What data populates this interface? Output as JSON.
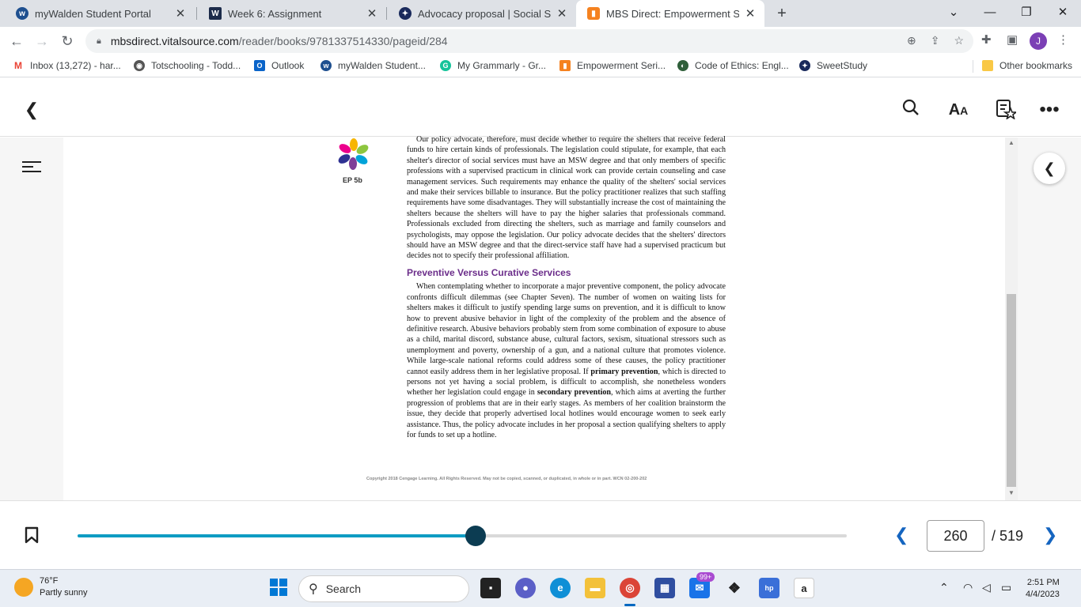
{
  "browser": {
    "tabs": [
      {
        "title": "myWalden Student Portal",
        "icon": "walden-icon",
        "color": "#1e4f8f"
      },
      {
        "title": "Week 6: Assignment",
        "icon": "walden-w-icon",
        "color": "#1c2b4a"
      },
      {
        "title": "Advocacy proposal | Social Scienc",
        "icon": "sweetstudy-icon",
        "color": "#1a2a5c"
      },
      {
        "title": "MBS Direct: Empowerment Series",
        "icon": "mbs-icon",
        "color": "#f58220"
      }
    ],
    "new_tab": "+",
    "url_host": "mbsdirect.vitalsource.com",
    "url_path": "/reader/books/9781337514330/pageid/284",
    "profile_initial": "J",
    "bookmarks": [
      {
        "label": "Inbox (13,272) - har...",
        "icon": "gmail-icon",
        "color": "#ea4335"
      },
      {
        "label": "Totschooling - Todd...",
        "icon": "totschooling-icon",
        "color": "#555555"
      },
      {
        "label": "Outlook",
        "icon": "outlook-icon",
        "color": "#0a64c9"
      },
      {
        "label": "myWalden Student...",
        "icon": "walden-icon",
        "color": "#1e4f8f"
      },
      {
        "label": "My Grammarly - Gr...",
        "icon": "grammarly-icon",
        "color": "#15c39a"
      },
      {
        "label": "Empowerment Seri...",
        "icon": "mbs-icon",
        "color": "#f58220"
      },
      {
        "label": "Code of Ethics: Engl...",
        "icon": "nasw-icon",
        "color": "#2f5f3a"
      },
      {
        "label": "SweetStudy",
        "icon": "sweetstudy-icon",
        "color": "#1a2a5c"
      }
    ],
    "other_bookmarks": "Other bookmarks"
  },
  "book": {
    "ep_label": "EP 5b",
    "para1": "Our policy advocate, therefore, must decide whether to require the shelters that receive federal funds to hire certain kinds of professionals. The legislation could stipulate, for example, that each shelter's director of social services must have an MSW degree and that only members of specific professions with a supervised practicum in clinical work can provide certain counseling and case management services. Such requirements may enhance the quality of the shelters' social services and make their services billable to insurance. But the policy practitioner realizes that such staffing requirements have some disadvantages. They will substantially increase the cost of maintaining the shelters because the shelters will have to pay the higher salaries that professionals command. Professionals excluded from directing the shelters, such as marriage and family counselors and psychologists, may oppose the legislation. Our policy advocate decides that the shelters' directors should have an MSW degree and that the direct-service staff have had a supervised practicum but decides not to specify their professional affiliation.",
    "heading": "Preventive Versus Curative Services",
    "para2_a": "When contemplating whether to incorporate a major preventive component, the policy advocate confronts difficult dilemmas (see Chapter Seven). The number of women on waiting lists for shelters makes it difficult to justify spending large sums on prevention, and it is difficult to know how to prevent abusive behavior in light of the complexity of the problem and the absence of definitive research. Abusive behaviors probably stem from some combination of exposure to abuse as a child, marital discord, substance abuse, cultural factors, sexism, situational stressors such as unemployment and poverty, ownership of a gun, and a national culture that promotes violence. While large-scale national reforms could address some of these causes, the policy practitioner cannot easily address them in her legislative proposal. If ",
    "term1": "primary prevention",
    "para2_b": ", which is directed to persons not yet having a social problem, is difficult to accomplish, she nonetheless wonders whether her legislation could engage in ",
    "term2": "secondary prevention",
    "para2_c": ", which aims at averting the further progression of problems that are in their early stages. As members of her coalition brainstorm the issue, they decide that properly advertised local hotlines would encourage women to seek early assistance. Thus, the policy advocate includes in her proposal a section qualifying shelters to apply for funds to set up a hotline.",
    "copyright": "Copyright 2018 Cengage Learning. All Rights Reserved. May not be copied, scanned, or duplicated, in whole or in part.  WCN 02-200-202"
  },
  "reader": {
    "current_page": "260",
    "total_pages": "/ 519",
    "progress": 0.518,
    "accent_color": "#0e9cc3"
  },
  "taskbar": {
    "temperature": "76°F",
    "condition": "Partly sunny",
    "search_label": "Search",
    "mail_badge": "99+",
    "time": "2:51 PM",
    "date": "4/4/2023"
  }
}
